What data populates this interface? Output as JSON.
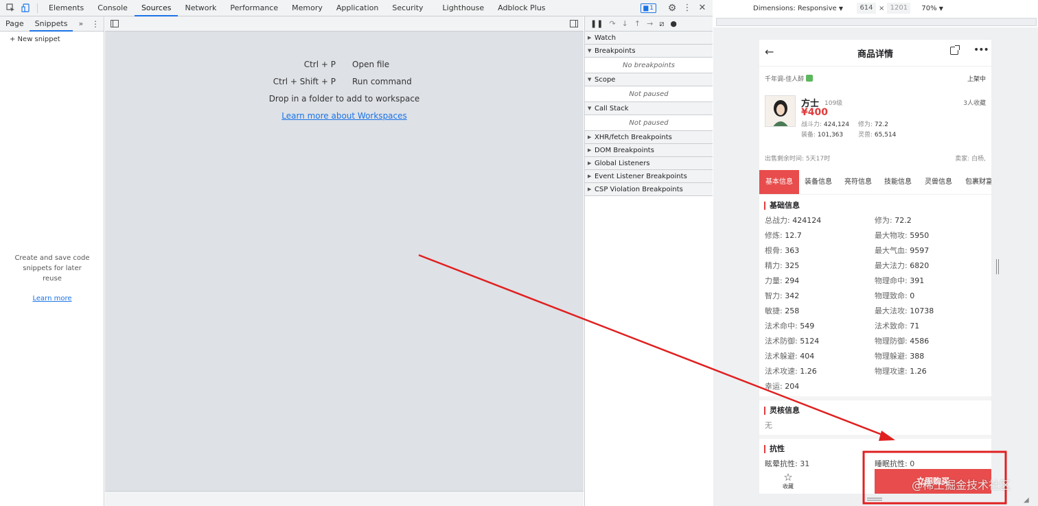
{
  "devtools": {
    "tabs": [
      "Elements",
      "Console",
      "Sources",
      "Network",
      "Performance",
      "Memory",
      "Application",
      "Security",
      "Lighthouse",
      "Adblock Plus"
    ],
    "active_tab": "Sources",
    "issues_badge": "1"
  },
  "left_panel": {
    "tabs": [
      "Page",
      "Snippets"
    ],
    "more": "»",
    "new_snippet": "+ New snippet",
    "empty_lines": [
      "Create and save code",
      "snippets for later",
      "reuse"
    ],
    "learn_more": "Learn more"
  },
  "editor": {
    "shortcuts": [
      {
        "key": "Ctrl + P",
        "label": "Open file"
      },
      {
        "key": "Ctrl + Shift + P",
        "label": "Run command"
      }
    ],
    "drop_text": "Drop in a folder to add to workspace",
    "learn_link": "Learn more about Workspaces"
  },
  "debugger": {
    "watch": "Watch",
    "breakpoints": "Breakpoints",
    "no_breakpoints": "No breakpoints",
    "scope": "Scope",
    "not_paused_1": "Not paused",
    "call_stack": "Call Stack",
    "not_paused_2": "Not paused",
    "sections": [
      "XHR/fetch Breakpoints",
      "DOM Breakpoints",
      "Global Listeners",
      "Event Listener Breakpoints",
      "CSP Violation Breakpoints"
    ]
  },
  "device_bar": {
    "dimensions": "Dimensions: Responsive",
    "width": "614",
    "times": "×",
    "height": "1201",
    "zoom": "70%"
  },
  "phone": {
    "title": "商品详情",
    "server": "千年调-佳人醉",
    "status": "上架中",
    "char_name": "方士",
    "level": "109级",
    "favorites": "3人收藏",
    "price": "¥400",
    "stats": {
      "zhandouli_label": "战斗力:",
      "zhandouli": "424,124",
      "xiuwei_label": "修为:",
      "xiuwei": "72.2",
      "zhuangbei_label": "装备:",
      "zhuangbei": "101,363",
      "lingshou_label": "灵兽:",
      "lingshou": "65,514"
    },
    "remaining_time": "出售剩余时间: 5天17时",
    "seller": "卖家: 白杨,",
    "tabs": [
      "基本信息",
      "装备信息",
      "亮符信息",
      "技能信息",
      "灵兽信息",
      "包裹财富"
    ],
    "basic_title": "基础信息",
    "basic_left": [
      {
        "k": "总战力:",
        "v": "424124"
      },
      {
        "k": "修炼:",
        "v": "12.7"
      },
      {
        "k": "根骨:",
        "v": "363"
      },
      {
        "k": "精力:",
        "v": "325"
      },
      {
        "k": "力量:",
        "v": "294"
      },
      {
        "k": "智力:",
        "v": "342"
      },
      {
        "k": "敏捷:",
        "v": "258"
      },
      {
        "k": "法术命中:",
        "v": "549"
      },
      {
        "k": "法术防御:",
        "v": "5124"
      },
      {
        "k": "法术躲避:",
        "v": "404"
      },
      {
        "k": "法术攻速:",
        "v": "1.26"
      },
      {
        "k": "幸运:",
        "v": "204"
      }
    ],
    "basic_right": [
      {
        "k": "修为:",
        "v": "72.2"
      },
      {
        "k": "最大物攻:",
        "v": "5950"
      },
      {
        "k": "最大气血:",
        "v": "9597"
      },
      {
        "k": "最大法力:",
        "v": "6820"
      },
      {
        "k": "物理命中:",
        "v": "391"
      },
      {
        "k": "物理致命:",
        "v": "0"
      },
      {
        "k": "最大法攻:",
        "v": "10738"
      },
      {
        "k": "法术致命:",
        "v": "71"
      },
      {
        "k": "物理防御:",
        "v": "4586"
      },
      {
        "k": "物理躲避:",
        "v": "388"
      },
      {
        "k": "物理攻速:",
        "v": "1.26"
      }
    ],
    "linghe_title": "灵核信息",
    "linghe_value": "无",
    "resist_title": "抗性",
    "resist_left_k": "眩晕抗性:",
    "resist_left_v": "31",
    "resist_right_k": "睡眠抗性:",
    "resist_right_v": "0",
    "fav_label": "收藏",
    "buy_label": "立即购买"
  },
  "watermark": "@稀土掘金技术社区",
  "colors": {
    "accent": "#1a73e8",
    "price": "#e03b3b",
    "buy": "#e84c4c",
    "annotation": "#e02020"
  }
}
